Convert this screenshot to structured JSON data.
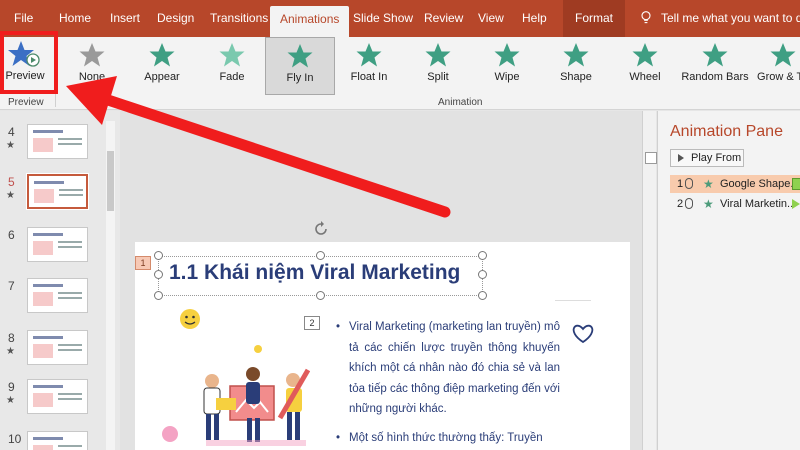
{
  "ribbon_tabs": [
    "File",
    "Home",
    "Insert",
    "Design",
    "Transitions",
    "Animations",
    "Slide Show",
    "Review",
    "View",
    "Help",
    "Format"
  ],
  "active_tab": "Animations",
  "tell_me": "Tell me what you want to do",
  "preview": {
    "label": "Preview",
    "group_label": "Preview"
  },
  "animation_group_label": "Animation",
  "effects": [
    {
      "label": "None",
      "icon": "star-none-icon",
      "color": "#9a9a9a"
    },
    {
      "label": "Appear",
      "icon": "star-appear-icon",
      "color": "#3f9f83"
    },
    {
      "label": "Fade",
      "icon": "star-fade-icon",
      "color": "#7ac9ae"
    },
    {
      "label": "Fly In",
      "icon": "star-flyin-icon",
      "color": "#3f9f83"
    },
    {
      "label": "Float In",
      "icon": "star-floatin-icon",
      "color": "#3f9f83"
    },
    {
      "label": "Split",
      "icon": "star-split-icon",
      "color": "#3f9f83"
    },
    {
      "label": "Wipe",
      "icon": "star-wipe-icon",
      "color": "#3f9f83"
    },
    {
      "label": "Shape",
      "icon": "star-shape-icon",
      "color": "#3f9f83"
    },
    {
      "label": "Wheel",
      "icon": "star-wheel-icon",
      "color": "#3f9f83"
    },
    {
      "label": "Random Bars",
      "icon": "star-randombars-icon",
      "color": "#3f9f83"
    },
    {
      "label": "Grow & Tu",
      "icon": "star-grow-icon",
      "color": "#3f9f83"
    }
  ],
  "selected_effect": "Fly In",
  "thumbnails": [
    {
      "number": "4",
      "has_animation": true
    },
    {
      "number": "5",
      "has_animation": true,
      "selected": true
    },
    {
      "number": "6",
      "has_animation": false
    },
    {
      "number": "7",
      "has_animation": false
    },
    {
      "number": "8",
      "has_animation": true
    },
    {
      "number": "9",
      "has_animation": true
    },
    {
      "number": "10",
      "has_animation": false
    }
  ],
  "slide": {
    "title": "1.1 Khái niệm Viral Marketing",
    "anim_tag_1": "1",
    "anim_tag_2": "2",
    "bullets": [
      "Viral Marketing (marketing lan truyền) mô tả các chiến lược truyền thông khuyến khích một cá nhân nào đó chia sẻ và lan tỏa tiếp các thông điệp marketing đến với những người khác.",
      "Một số hình thức thường thấy: Truyền"
    ]
  },
  "animation_pane": {
    "title": "Animation Pane",
    "play_from": "Play From",
    "items": [
      {
        "number": "1",
        "label": "Google Shape..."
      },
      {
        "number": "2",
        "label": "Viral Marketin..."
      }
    ]
  },
  "colors": {
    "ribbon": "#b7472a",
    "accent_green": "#3f9f83",
    "title_blue": "#2a3d78",
    "annotation_red": "#f01d1d"
  }
}
